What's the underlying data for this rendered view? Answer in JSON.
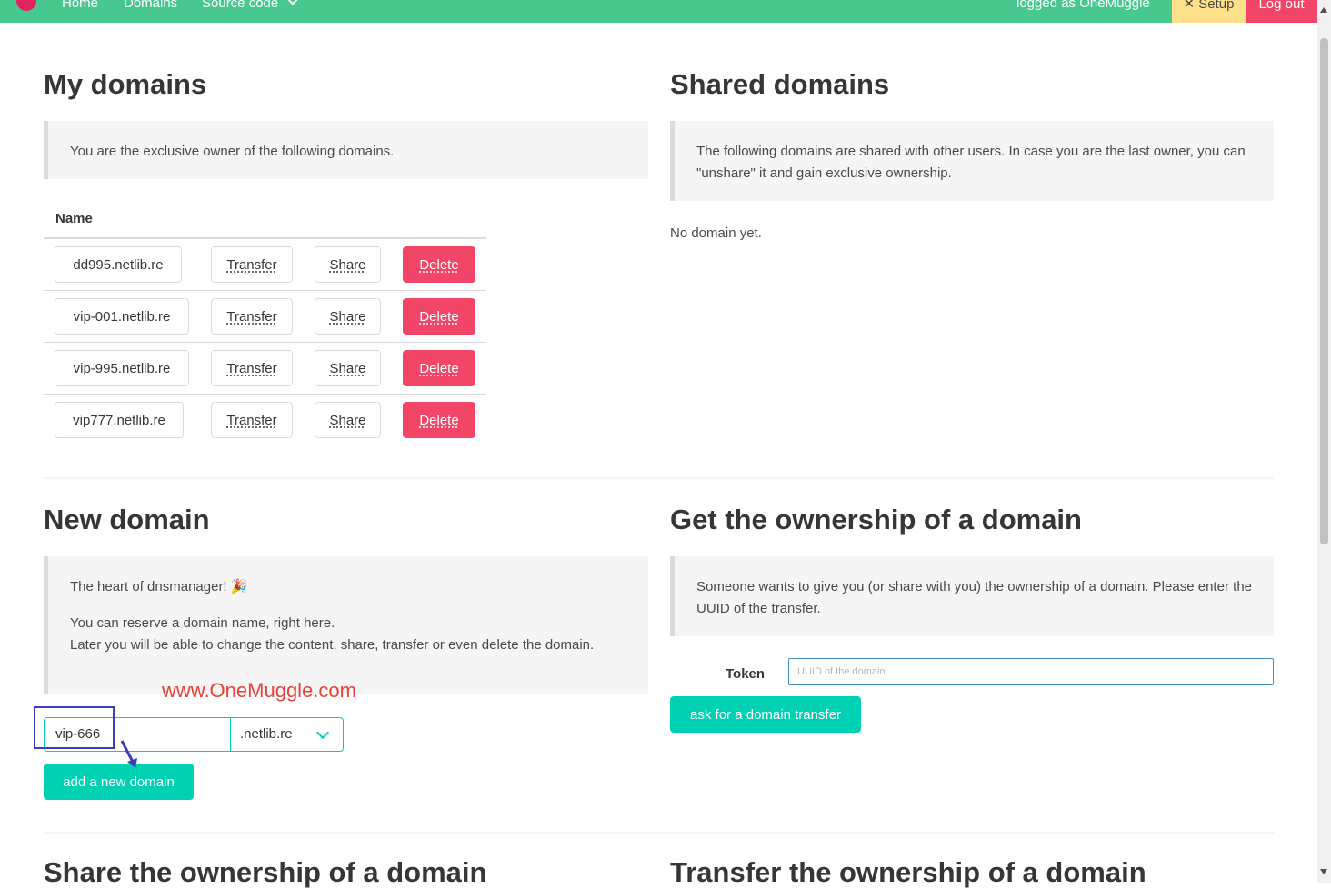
{
  "navbar": {
    "home": "Home",
    "domains": "Domains",
    "source_code": "Source code",
    "logged_as": "logged as OneMuggle",
    "setup": "✕ Setup",
    "logout": "Log out"
  },
  "my_domains": {
    "title": "My domains",
    "note": "You are the exclusive owner of the following domains.",
    "column_name": "Name",
    "transfer_label": "Transfer",
    "share_label": "Share",
    "delete_label": "Delete",
    "domains": [
      "dd995.netlib.re",
      "vip-001.netlib.re",
      "vip-995.netlib.re",
      "vip777.netlib.re"
    ]
  },
  "shared_domains": {
    "title": "Shared domains",
    "note": "The following domains are shared with other users. In case you are the last owner, you can \"unshare\" it and gain exclusive ownership.",
    "empty": "No domain yet."
  },
  "new_domain": {
    "title": "New domain",
    "note_line1": "The heart of dnsmanager! 🎉",
    "note_line2": "You can reserve a domain name, right here.",
    "note_line3": "Later you will be able to change the content, share, transfer or even delete the domain.",
    "name_value": "vip-666",
    "tld_value": ".netlib.re",
    "add_button": "add a new domain"
  },
  "get_ownership": {
    "title": "Get the ownership of a domain",
    "note": "Someone wants to give you (or share with you) the ownership of a domain. Please enter the UUID of the transfer.",
    "token_label": "Token",
    "token_placeholder": "UUID of the domain",
    "ask_button": "ask for a domain transfer"
  },
  "share_ownership": {
    "title": "Share the ownership of a domain"
  },
  "transfer_ownership": {
    "title": "Transfer the ownership of a domain"
  },
  "watermark": "www.OneMuggle.com",
  "colors": {
    "navbar": "#48c78e",
    "primary": "#00d1b2",
    "danger": "#f14668",
    "warning": "#ffe08a",
    "annotation": "#3c3fb9"
  }
}
